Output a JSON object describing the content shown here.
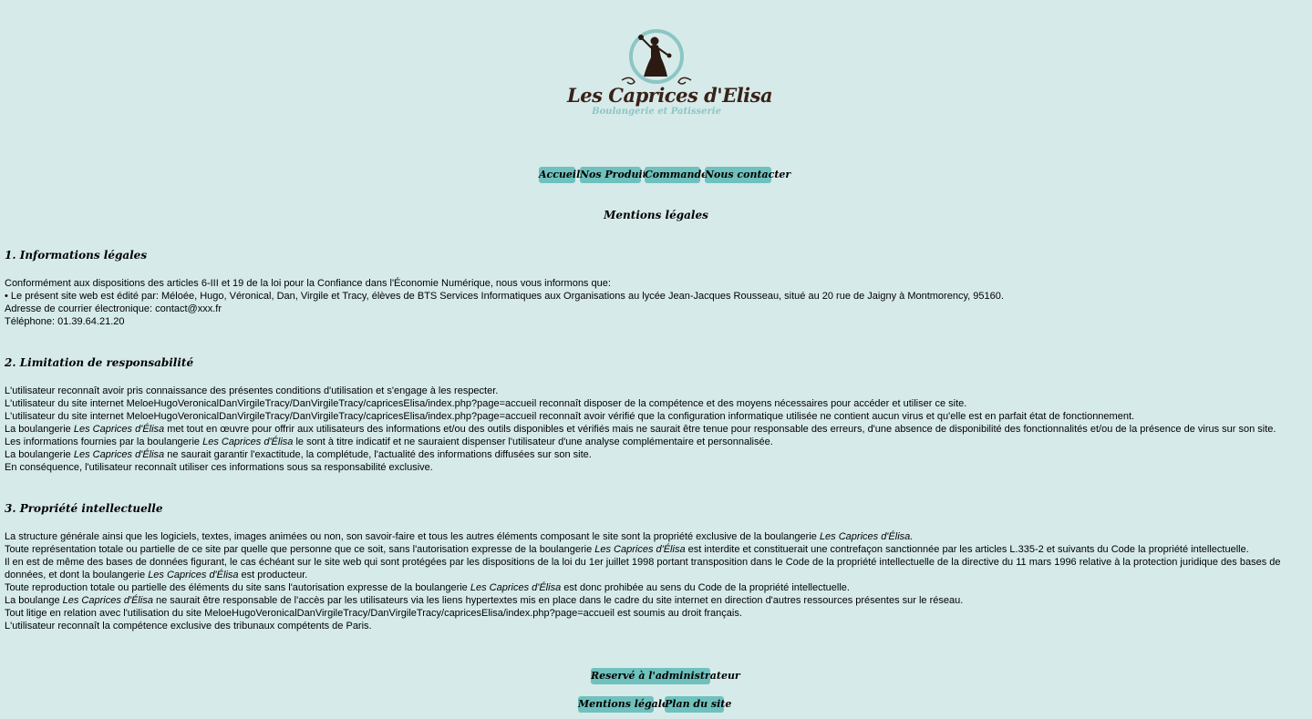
{
  "logo": {
    "title": "Les Caprices d'Elisa",
    "subtitle": "Boulangerie et Patisserie",
    "icon": "woman-silhouette-cupcake-icon",
    "colors": {
      "dark": "#3a2218",
      "teal": "#8cc6c4"
    }
  },
  "nav": {
    "items": [
      "Accueil",
      "Nos Produits",
      "Commander",
      "Nous contacter"
    ]
  },
  "page_title": "Mentions légales",
  "section1": {
    "heading": "1. Informations légales",
    "lines": [
      "Conformément aux dispositions des articles 6-III et 19 de la loi pour la Confiance dans l'Économie Numérique, nous vous informons que:",
      "• Le présent site web est édité par: Méloée, Hugo, Véronical, Dan, Virgile et Tracy, élèves de BTS Services Informatiques aux Organisations au lycée Jean-Jacques Rousseau, situé au 20 rue de Jaigny à Montmorency, 95160.",
      "Adresse de courrier électronique: contact@xxx.fr",
      "Téléphone: 01.39.64.21.20"
    ]
  },
  "section2": {
    "heading": "2. Limitation de responsabilité",
    "brand": "Les Caprices d'Élisa",
    "l1": "L'utilisateur reconnaît avoir pris connaissance des présentes conditions d'utilisation et s'engage à les respecter.",
    "l2": "L'utilisateur du site internet MeloeHugoVeronicalDanVirgileTracy/DanVirgileTracy/capricesElisa/index.php?page=accueil reconnaît disposer de la compétence et des moyens nécessaires pour accéder et utiliser ce site.",
    "l3": "L'utilisateur du site internet MeloeHugoVeronicalDanVirgileTracy/DanVirgileTracy/capricesElisa/index.php?page=accueil reconnaît avoir vérifié que la configuration informatique utilisée ne contient aucun virus et qu'elle est en parfait état de fonctionnement.",
    "l4a": "La boulangerie ",
    "l4b": " met tout en œuvre pour offrir aux utilisateurs des informations et/ou des outils disponibles et vérifiés mais ne saurait être tenue pour responsable des erreurs, d'une absence de disponibilité des fonctionnalités et/ou de la présence de virus sur son site.",
    "l5a": "Les informations fournies par la boulangerie ",
    "l5b": " le sont à titre indicatif et ne sauraient dispenser l'utilisateur d'une analyse complémentaire et personnalisée.",
    "l6a": "La boulangerie ",
    "l6b": " ne saurait garantir l'exactitude, la complétude, l'actualité des informations diffusées sur son site.",
    "l7": "En conséquence, l'utilisateur reconnaît utiliser ces informations sous sa responsabilité exclusive."
  },
  "section3": {
    "heading": "3. Propriété intellectuelle",
    "brand_full": "Les Caprices d'Élisa.",
    "brand": "Les Caprices d'Élisa",
    "l1a": "La structure générale ainsi que les logiciels, textes, images animées ou non, son savoir-faire et tous les autres éléments composant le site sont la propriété exclusive de la boulangerie ",
    "l2a": "Toute représentation totale ou partielle de ce site par quelle que personne que ce soit, sans l'autorisation expresse de la boulangerie ",
    "l2b": " est interdite et constituerait une contrefaçon sanctionnée par les articles L.335-2 et suivants du Code la propriété intellectuelle.",
    "l3a": "Il en est de même des bases de données figurant, le cas échéant sur le site web qui sont protégées par les dispositions de la loi du 1er juillet 1998 portant transposition dans le Code de la propriété intellectuelle de la directive du 11 mars 1996 relative à la protection juridique des bases de données, et dont la boulangerie ",
    "l3b": " est producteur.",
    "l4a": "Toute reproduction totale ou partielle des éléments du site sans l'autorisation expresse de la boulangerie ",
    "l4b": " est donc prohibée au sens du Code de la propriété intellectuelle.",
    "l5a": "La boulange ",
    "l5b": " ne saurait être responsable de l'accès par les utilisateurs via les liens hypertextes mis en place dans le cadre du site internet en direction d'autres ressources présentes sur le réseau.",
    "l6": "Tout litige en relation avec l'utilisation du site MeloeHugoVeronicalDanVirgileTracy/DanVirgileTracy/capricesElisa/index.php?page=accueil est soumis au droit français.",
    "l7": "L'utilisateur reconnaît la compétence exclusive des tribunaux compétents de Paris."
  },
  "footer": {
    "admin": "Reservé à l'administrateur",
    "mentions": "Mentions légales",
    "plan": "Plan du site"
  }
}
